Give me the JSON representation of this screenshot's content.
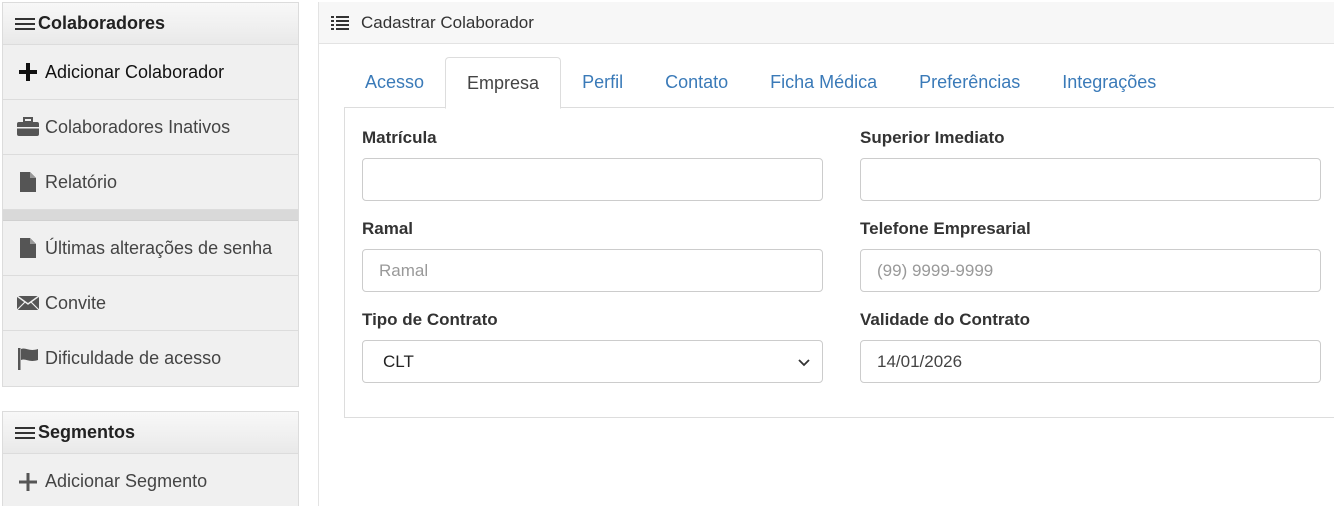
{
  "sidebar": {
    "colaboradores": {
      "title": "Colaboradores",
      "items": [
        {
          "label": "Adicionar Colaborador",
          "icon": "plus-icon"
        },
        {
          "label": "Colaboradores Inativos",
          "icon": "briefcase-icon"
        },
        {
          "label": "Relatório",
          "icon": "document-icon"
        },
        {
          "label": "Últimas alterações de senha",
          "icon": "document-icon"
        },
        {
          "label": "Convite",
          "icon": "envelope-icon"
        },
        {
          "label": "Dificuldade de acesso",
          "icon": "flag-icon"
        }
      ]
    },
    "segmentos": {
      "title": "Segmentos",
      "items": [
        {
          "label": "Adicionar Segmento",
          "icon": "plus-icon"
        }
      ]
    }
  },
  "main": {
    "title": "Cadastrar Colaborador",
    "tabs": [
      {
        "label": "Acesso"
      },
      {
        "label": "Empresa"
      },
      {
        "label": "Perfil"
      },
      {
        "label": "Contato"
      },
      {
        "label": "Ficha Médica"
      },
      {
        "label": "Preferências"
      },
      {
        "label": "Integrações"
      }
    ],
    "active_tab": "Empresa",
    "form": {
      "matricula": {
        "label": "Matrícula",
        "value": ""
      },
      "superior": {
        "label": "Superior Imediato",
        "value": ""
      },
      "ramal": {
        "label": "Ramal",
        "placeholder": "Ramal"
      },
      "telefone": {
        "label": "Telefone Empresarial",
        "placeholder": "(99) 9999-9999"
      },
      "tipo_contrato": {
        "label": "Tipo de Contrato",
        "value": "CLT"
      },
      "validade": {
        "label": "Validade do Contrato",
        "value": "14/01/2026"
      }
    }
  },
  "colors": {
    "link": "#3a7ab8",
    "border": "#cccccc"
  }
}
